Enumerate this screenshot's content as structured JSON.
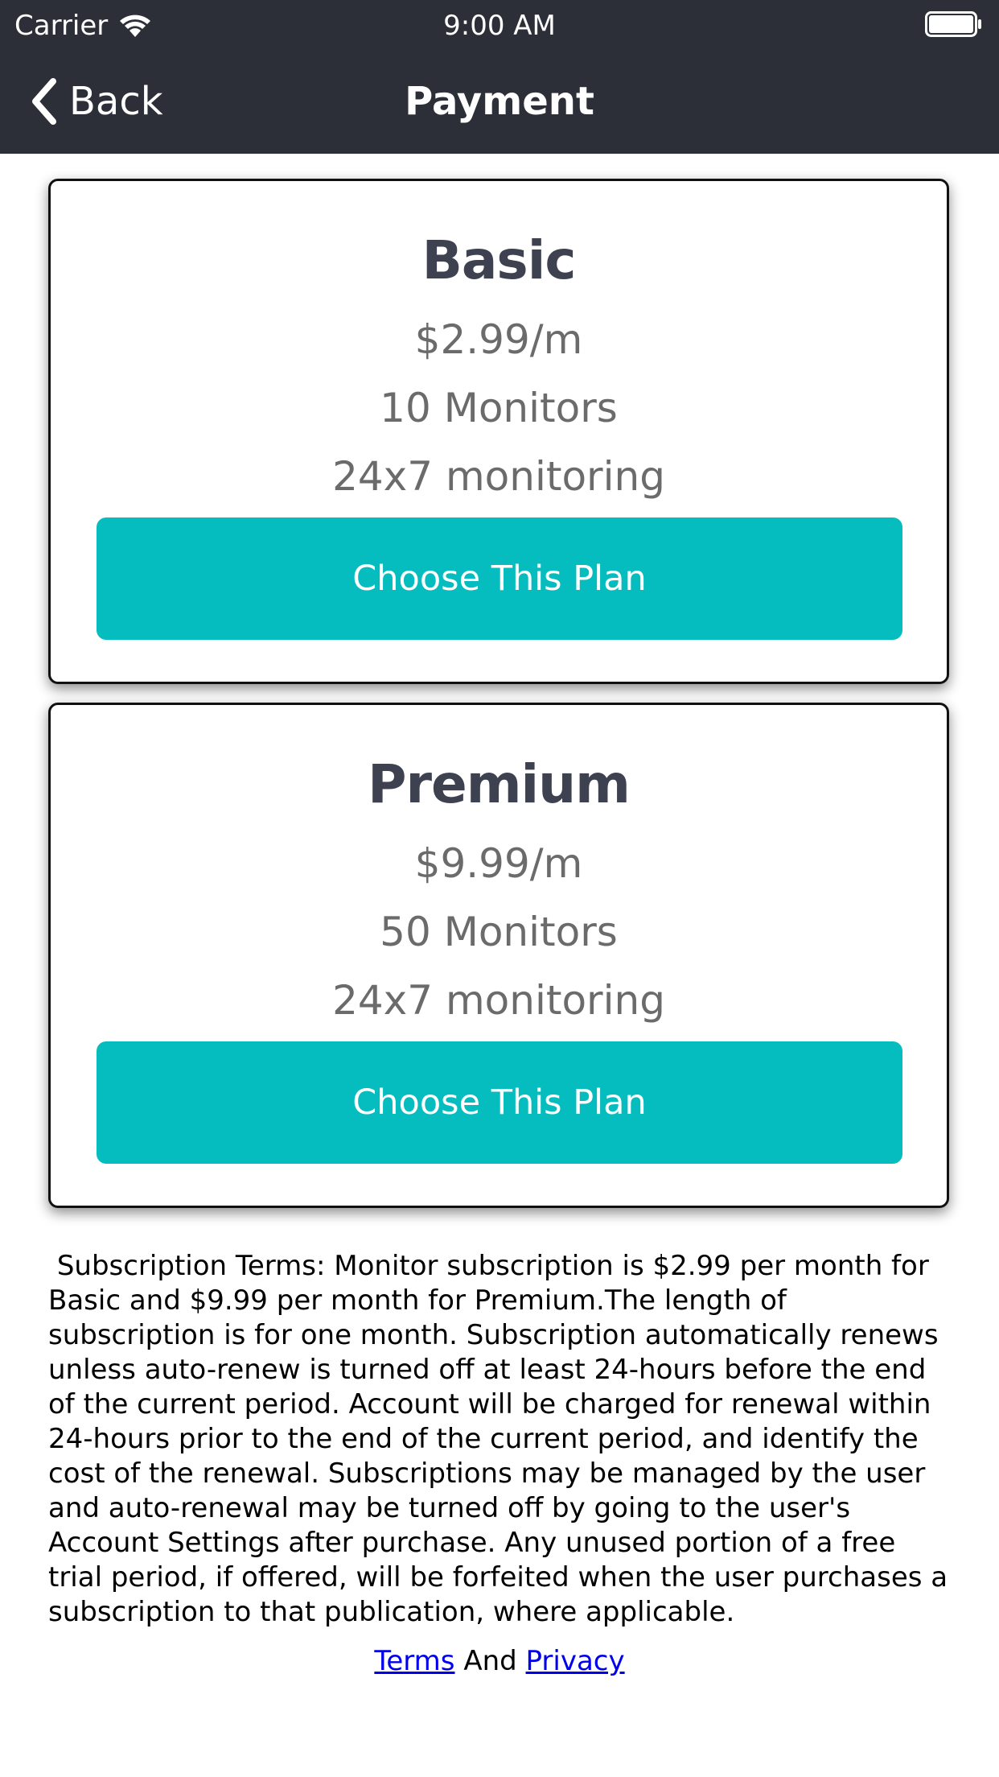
{
  "status_bar": {
    "carrier": "Carrier",
    "time": "9:00 AM"
  },
  "nav": {
    "back_label": "Back",
    "title": "Payment"
  },
  "plans": [
    {
      "name": "Basic",
      "price": "$2.99/m",
      "monitors": "10 Monitors",
      "monitoring": "24x7 monitoring",
      "button_label": "Choose This Plan"
    },
    {
      "name": "Premium",
      "price": "$9.99/m",
      "monitors": "50 Monitors",
      "monitoring": "24x7 monitoring",
      "button_label": "Choose This Plan"
    }
  ],
  "terms": {
    "text": " Subscription Terms: Monitor subscription is $2.99 per month for Basic and $9.99 per month for Premium.The length of subscription is for one month. Subscription automatically renews unless auto-renew is turned off at least 24-hours before the end of the current period. Account will be charged for renewal within 24-hours prior to the end of the current period, and identify the cost of the renewal. Subscriptions may be managed by the user and auto-renewal may be turned off by going to the user's Account Settings after purchase. Any unused portion of a free trial period, if offered, will be forfeited when the user purchases a subscription to that publication, where applicable.",
    "terms_link": "Terms",
    "and_text": "And",
    "privacy_link": "Privacy"
  },
  "colors": {
    "nav_background": "#2c2f37",
    "button_accent": "#05bdbe",
    "plan_title": "#3d4150",
    "plan_detail": "#6b6b6b",
    "link": "#0000ee"
  },
  "icons": {
    "wifi": "wifi-icon",
    "battery": "battery-icon",
    "back": "back-chevron-icon"
  }
}
